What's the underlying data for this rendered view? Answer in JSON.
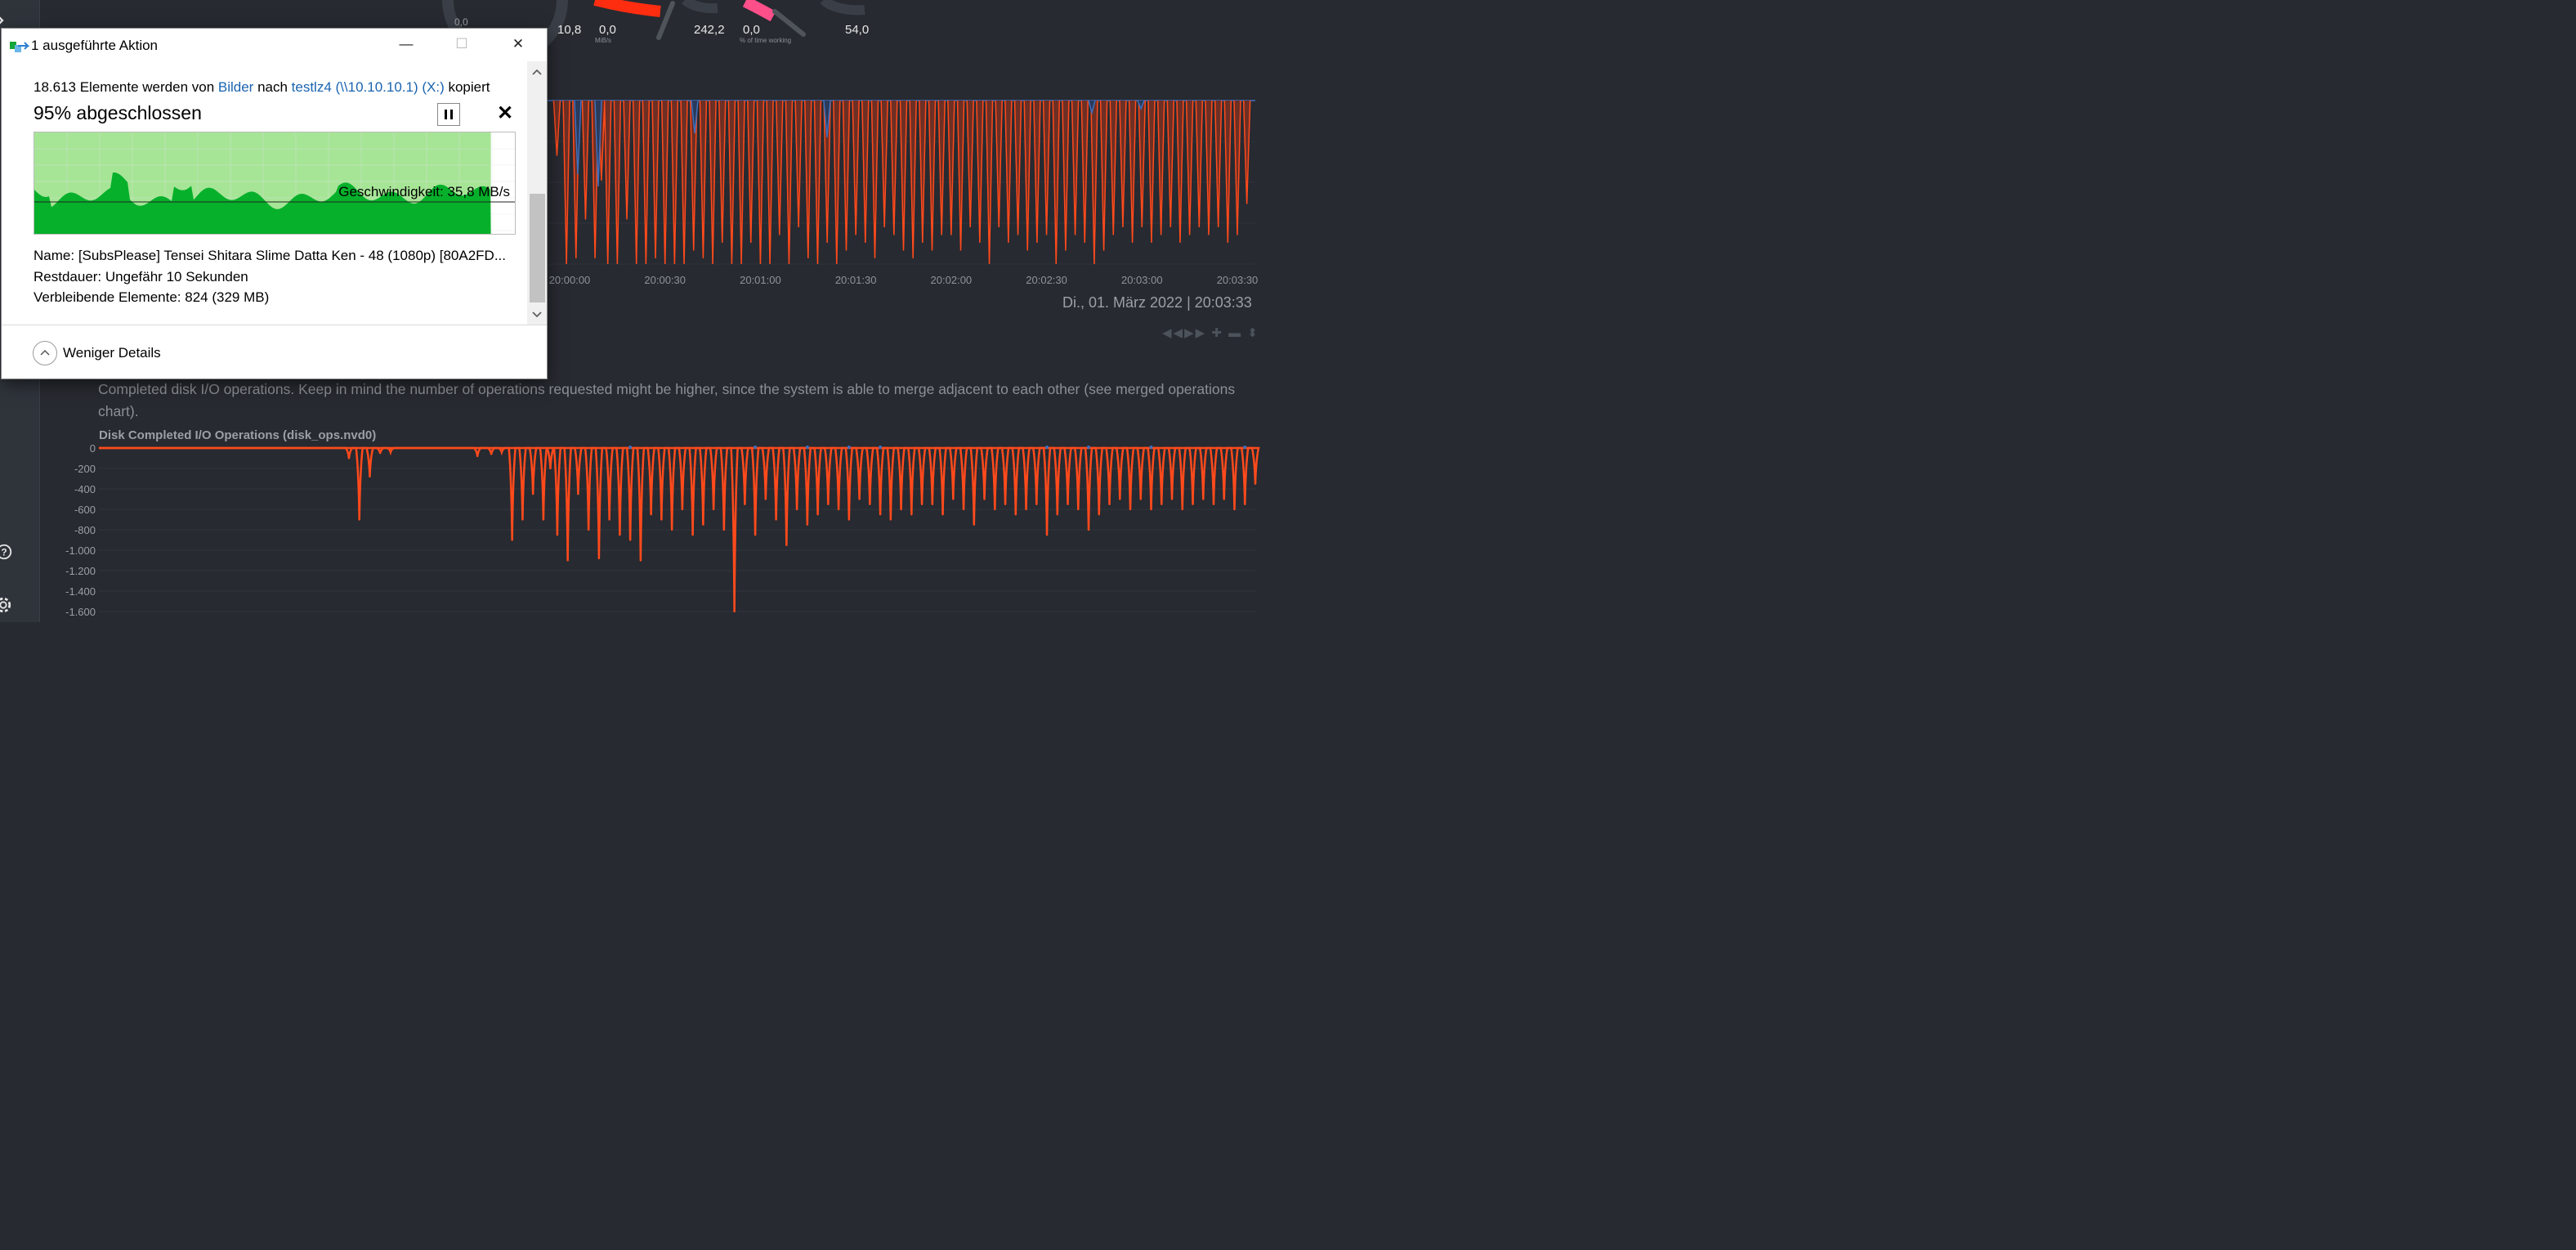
{
  "gauges": [
    {
      "value": "0,0",
      "unit": ""
    },
    {
      "value": "10,8",
      "unit": ""
    },
    {
      "value": "0,0",
      "unit": "MiB/s"
    },
    {
      "value": "242,2",
      "unit": ""
    },
    {
      "value": "0,0",
      "unit": "% of time working"
    },
    {
      "value": "54,0",
      "unit": ""
    }
  ],
  "colors": {
    "background": "#272a30",
    "series_write": "#ff4a1c",
    "series_read": "#3d6fbf",
    "gauge_red": "#ff2d10",
    "gauge_pink": "#ff4f8a",
    "progress_fill": "#06b02b",
    "progress_bg": "#a6e596",
    "link": "#1a64b0"
  },
  "top_chart": {
    "x_ticks": [
      "20:00:00",
      "20:00:30",
      "20:01:00",
      "20:01:30",
      "20:02:00",
      "20:02:30",
      "20:03:00",
      "20:03:30"
    ]
  },
  "timestamp": "Di., 01. März 2022 | 20:03:33",
  "description": "Completed disk I/O operations. Keep in mind the number of operations requested might be higher, since the system is able to merge adjacent to each other (see merged operations chart).",
  "chart_data": {
    "type": "area",
    "title": "Disk Completed I/O Operations (disk_ops.nvd0)",
    "ylim": [
      -1600,
      0
    ],
    "y_ticks": [
      "0",
      "-200",
      "-400",
      "-600",
      "-800",
      "-1.000",
      "-1.200",
      "-1.400",
      "-1.600"
    ],
    "grid": true,
    "series": [
      {
        "color": "#ff4a1c",
        "x": [
          "19:59:12",
          "19:59:15",
          "19:59:18",
          "19:59:21",
          "19:59:24",
          "19:59:49",
          "19:59:53",
          "19:59:56",
          "19:59:59",
          "20:00:02",
          "20:00:05",
          "20:00:08",
          "20:00:10",
          "20:00:12",
          "20:00:15",
          "20:00:18",
          "20:00:21",
          "20:00:24",
          "20:00:27",
          "20:00:30",
          "20:00:33",
          "20:00:36",
          "20:00:39",
          "20:00:42",
          "20:00:45",
          "20:00:48",
          "20:00:51",
          "20:00:54",
          "20:00:57",
          "20:01:00",
          "20:01:03",
          "20:01:06",
          "20:01:09",
          "20:01:12",
          "20:01:15",
          "20:01:18",
          "20:01:21",
          "20:01:24",
          "20:01:27",
          "20:01:30",
          "20:01:33",
          "20:01:36",
          "20:01:39",
          "20:01:42",
          "20:01:45",
          "20:01:48",
          "20:01:51",
          "20:01:54",
          "20:01:57",
          "20:02:00",
          "20:02:03",
          "20:02:06",
          "20:02:09",
          "20:02:12",
          "20:02:15",
          "20:02:18",
          "20:02:21",
          "20:02:24",
          "20:02:27",
          "20:02:30",
          "20:02:33",
          "20:02:36",
          "20:02:39",
          "20:02:42",
          "20:02:45",
          "20:02:48",
          "20:02:51",
          "20:02:54",
          "20:02:57",
          "20:03:00",
          "20:03:03",
          "20:03:06",
          "20:03:09",
          "20:03:12",
          "20:03:15",
          "20:03:18",
          "20:03:21",
          "20:03:24",
          "20:03:27",
          "20:03:30",
          "20:03:33"
        ],
        "y": [
          -100,
          -700,
          -280,
          -50,
          -40,
          -80,
          -60,
          -40,
          -900,
          -700,
          -450,
          -700,
          -200,
          -850,
          -1100,
          -450,
          -800,
          -1080,
          -700,
          -850,
          -900,
          -1100,
          -650,
          -700,
          -800,
          -600,
          -850,
          -750,
          -600,
          -800,
          -1600,
          -550,
          -850,
          -500,
          -700,
          -950,
          -600,
          -750,
          -650,
          -550,
          -600,
          -700,
          -500,
          -550,
          -650,
          -700,
          -600,
          -650,
          -550,
          -550,
          -650,
          -500,
          -600,
          -750,
          -500,
          -600,
          -550,
          -650,
          -600,
          -550,
          -850,
          -650,
          -550,
          -600,
          -800,
          -650,
          -550,
          -500,
          -600,
          -500,
          -600,
          -550,
          -500,
          -600,
          -550,
          -500,
          -550,
          -500,
          -600,
          -550,
          -350
        ]
      }
    ]
  },
  "dialog": {
    "title": "1 ausgeführte Aktion",
    "minimize": "—",
    "maximize": "☐",
    "close": "✕",
    "copy_prefix": "18.613 Elemente werden von ",
    "copy_source": "Bilder",
    "copy_mid": " nach ",
    "copy_dest": "testlz4 (\\\\10.10.10.1) (X:)",
    "copy_suffix": " kopiert",
    "progress_title": "95% abgeschlossen",
    "progress_percent": 95,
    "speed": "Geschwindigkeit: 35,8 MB/s",
    "name_label": "Name:",
    "name_value": "[SubsPlease] Tensei Shitara Slime Datta Ken - 48 (1080p) [80A2FD...",
    "remaining_time_label": "Restdauer:",
    "remaining_time_value": "Ungefähr 10 Sekunden",
    "remaining_items_label": "Verbleibende Elemente:",
    "remaining_items_value": "824 (329 MB)",
    "less_details": "Weniger Details"
  }
}
